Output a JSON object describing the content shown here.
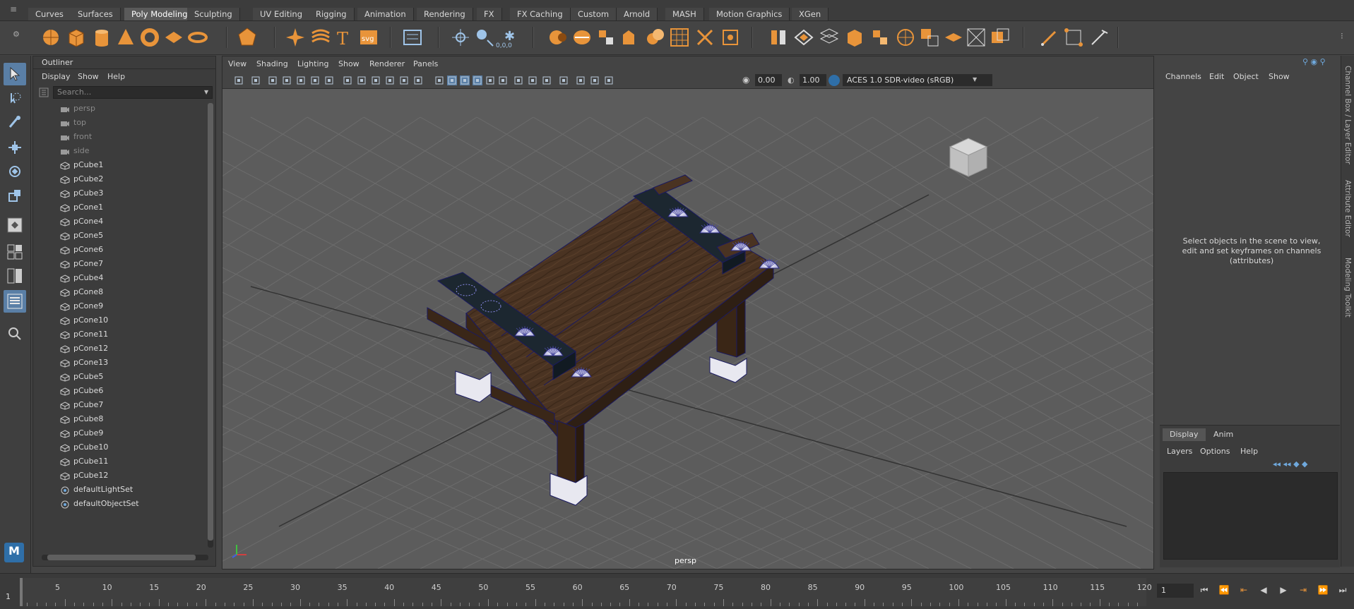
{
  "shelf": {
    "tabs": [
      "Curves",
      "Surfaces",
      "Poly Modeling",
      "Sculpting",
      "UV Editing",
      "Rigging",
      "Animation",
      "Rendering",
      "FX",
      "FX Caching",
      "Custom",
      "Arnold",
      "MASH",
      "Motion Graphics",
      "XGen"
    ],
    "active_tab": "Poly Modeling",
    "svg_label": "svg",
    "coord_label": "0,0,0"
  },
  "outliner": {
    "title": "Outliner",
    "menus": [
      "Display",
      "Show",
      "Help"
    ],
    "search_placeholder": "Search...",
    "items": [
      {
        "label": "persp",
        "type": "camera"
      },
      {
        "label": "top",
        "type": "camera"
      },
      {
        "label": "front",
        "type": "camera"
      },
      {
        "label": "side",
        "type": "camera"
      },
      {
        "label": "pCube1",
        "type": "mesh"
      },
      {
        "label": "pCube2",
        "type": "mesh"
      },
      {
        "label": "pCube3",
        "type": "mesh"
      },
      {
        "label": "pCone1",
        "type": "mesh"
      },
      {
        "label": "pCone4",
        "type": "mesh"
      },
      {
        "label": "pCone5",
        "type": "mesh"
      },
      {
        "label": "pCone6",
        "type": "mesh"
      },
      {
        "label": "pCone7",
        "type": "mesh"
      },
      {
        "label": "pCube4",
        "type": "mesh"
      },
      {
        "label": "pCone8",
        "type": "mesh"
      },
      {
        "label": "pCone9",
        "type": "mesh"
      },
      {
        "label": "pCone10",
        "type": "mesh"
      },
      {
        "label": "pCone11",
        "type": "mesh"
      },
      {
        "label": "pCone12",
        "type": "mesh"
      },
      {
        "label": "pCone13",
        "type": "mesh"
      },
      {
        "label": "pCube5",
        "type": "mesh"
      },
      {
        "label": "pCube6",
        "type": "mesh"
      },
      {
        "label": "pCube7",
        "type": "mesh"
      },
      {
        "label": "pCube8",
        "type": "mesh"
      },
      {
        "label": "pCube9",
        "type": "mesh"
      },
      {
        "label": "pCube10",
        "type": "mesh"
      },
      {
        "label": "pCube11",
        "type": "mesh"
      },
      {
        "label": "pCube12",
        "type": "mesh"
      },
      {
        "label": "defaultLightSet",
        "type": "set"
      },
      {
        "label": "defaultObjectSet",
        "type": "set"
      }
    ]
  },
  "viewport": {
    "menus": [
      "View",
      "Shading",
      "Lighting",
      "Show",
      "Renderer",
      "Panels"
    ],
    "exposure": "0.00",
    "gamma": "1.00",
    "color_space": "ACES 1.0 SDR-video (sRGB)",
    "camera_label": "persp"
  },
  "channel_box": {
    "menus": [
      "Channels",
      "Edit",
      "Object",
      "Show"
    ],
    "message_lines": [
      "Select objects in the scene to view,",
      "edit and set keyframes on channels",
      "(attributes)"
    ]
  },
  "layers": {
    "tabs": [
      "Display",
      "Anim"
    ],
    "menus": [
      "Layers",
      "Options",
      "Help"
    ]
  },
  "side_tabs": [
    "Channel Box / Layer Editor",
    "Attribute Editor",
    "Modeling Toolkit"
  ],
  "timeline": {
    "start_label": "1",
    "ticks": [
      "5",
      "10",
      "15",
      "20",
      "25",
      "30",
      "35",
      "40",
      "45",
      "50",
      "55",
      "60",
      "65",
      "70",
      "75",
      "80",
      "85",
      "90",
      "95",
      "100",
      "105",
      "110",
      "115",
      "120"
    ],
    "current_frame": "1"
  },
  "colors": {
    "accent": "#5a7fa6",
    "shelf_orange": "#e8943a",
    "wood": "#4a3322",
    "dark_beam": "#1c2730"
  }
}
